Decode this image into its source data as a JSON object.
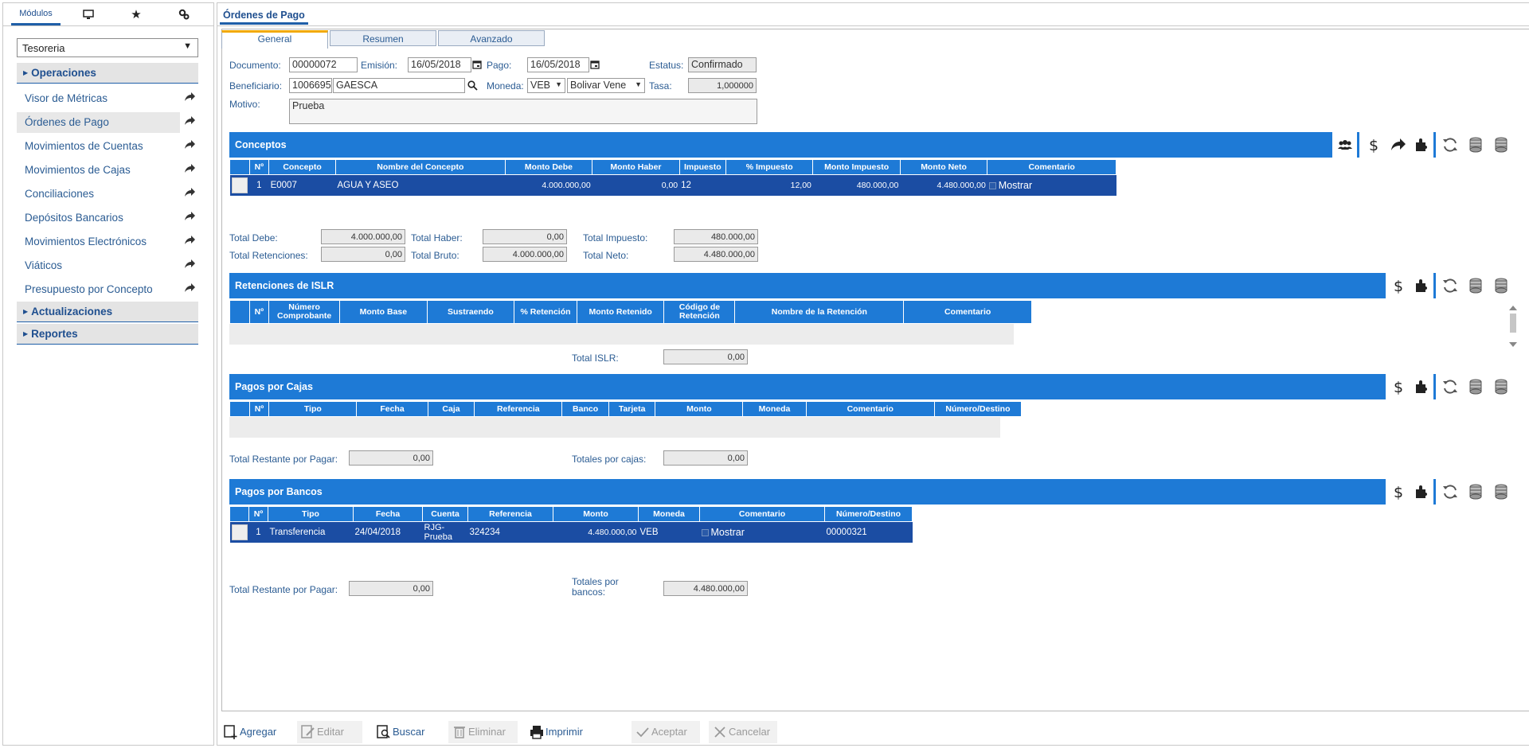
{
  "sidebar": {
    "tabs": [
      {
        "label": "Módulos",
        "icon": "modules"
      },
      {
        "label": "",
        "icon": "monitor-icon"
      },
      {
        "label": "",
        "icon": "star-icon"
      },
      {
        "label": "",
        "icon": "gears-icon"
      }
    ],
    "module_select": "Tesoreria",
    "sections": {
      "operaciones": "Operaciones",
      "actualizaciones": "Actualizaciones",
      "reportes": "Reportes"
    },
    "items": [
      {
        "label": "Visor de Métricas"
      },
      {
        "label": "Órdenes de Pago"
      },
      {
        "label": "Movimientos de Cuentas"
      },
      {
        "label": "Movimientos de Cajas"
      },
      {
        "label": "Conciliaciones"
      },
      {
        "label": "Depósitos Bancarios"
      },
      {
        "label": "Movimientos Electrónicos"
      },
      {
        "label": "Viáticos"
      },
      {
        "label": "Presupuesto por Concepto"
      }
    ]
  },
  "main": {
    "title": "Órdenes de Pago",
    "form_tabs": [
      "General",
      "Resumen",
      "Avanzado"
    ],
    "form": {
      "documento_label": "Documento:",
      "documento": "00000072",
      "emision_label": "Emisión:",
      "emision": "16/05/2018",
      "pago_label": "Pago:",
      "pago": "16/05/2018",
      "estatus_label": "Estatus:",
      "estatus": "Confirmado",
      "beneficiario_label": "Beneficiario:",
      "beneficiario_codigo": "1006695",
      "beneficiario_nombre": "GAESCA",
      "moneda_label": "Moneda:",
      "moneda": "VEB",
      "moneda_nombre": "Bolivar Vene",
      "tasa_label": "Tasa:",
      "tasa": "1,000000",
      "motivo_label": "Motivo:",
      "motivo": "Prueba"
    }
  },
  "conceptos": {
    "title": "Conceptos",
    "headers": [
      "Nº",
      "Concepto",
      "Nombre del Concepto",
      "Monto Debe",
      "Monto Haber",
      "Impuesto",
      "% Impuesto",
      "Monto Impuesto",
      "Monto Neto",
      "Comentario"
    ],
    "rows": [
      {
        "n": "1",
        "concepto": "E0007",
        "nombre": "AGUA Y ASEO",
        "debe": "4.000.000,00",
        "haber": "0,00",
        "impuesto": "12",
        "pct": "12,00",
        "monto_impuesto": "480.000,00",
        "neto": "4.480.000,00",
        "comentario": "Mostrar"
      }
    ],
    "totals": {
      "total_debe_label": "Total Debe:",
      "total_debe": "4.000.000,00",
      "total_haber_label": "Total Haber:",
      "total_haber": "0,00",
      "total_impuesto_label": "Total Impuesto:",
      "total_impuesto": "480.000,00",
      "total_retenciones_label": "Total Retenciones:",
      "total_retenciones": "0,00",
      "total_bruto_label": "Total Bruto:",
      "total_bruto": "4.000.000,00",
      "total_neto_label": "Total Neto:",
      "total_neto": "4.480.000,00"
    }
  },
  "retenciones": {
    "title": "Retenciones de ISLR",
    "headers": [
      "Nº",
      "Número Comprobante",
      "Monto Base",
      "Sustraendo",
      "% Retención",
      "Monto Retenido",
      "Código de Retención",
      "Nombre de la Retención",
      "Comentario"
    ],
    "total_label": "Total ISLR:",
    "total": "0,00"
  },
  "cajas": {
    "title": "Pagos por Cajas",
    "headers": [
      "Nº",
      "Tipo",
      "Fecha",
      "Caja",
      "Referencia",
      "Banco",
      "Tarjeta",
      "Monto",
      "Moneda",
      "Comentario",
      "Número/Destino"
    ],
    "restante_label": "Total Restante por Pagar:",
    "restante": "0,00",
    "totales_label": "Totales por cajas:",
    "totales": "0,00"
  },
  "bancos": {
    "title": "Pagos por Bancos",
    "headers": [
      "Nº",
      "Tipo",
      "Fecha",
      "Cuenta",
      "Referencia",
      "Monto",
      "Moneda",
      "Comentario",
      "Número/Destino"
    ],
    "rows": [
      {
        "n": "1",
        "tipo": "Transferencia",
        "fecha": "24/04/2018",
        "cuenta": "RJG-Prueba",
        "referencia": "324234",
        "monto": "4.480.000,00",
        "moneda": "VEB",
        "comentario": "Mostrar",
        "destino": "00000321"
      }
    ],
    "restante_label": "Total Restante por Pagar:",
    "restante": "0,00",
    "totales_label": "Totales por bancos:",
    "totales": "4.480.000,00"
  },
  "toolbar": {
    "agregar": "Agregar",
    "editar": "Editar",
    "buscar": "Buscar",
    "eliminar": "Eliminar",
    "imprimir": "Imprimir",
    "aceptar": "Aceptar",
    "cancelar": "Cancelar"
  },
  "colors": {
    "accent": "#1e7ad6",
    "row": "#1b4da3",
    "tab_accent": "#f2a900",
    "link": "#2b5c93"
  }
}
